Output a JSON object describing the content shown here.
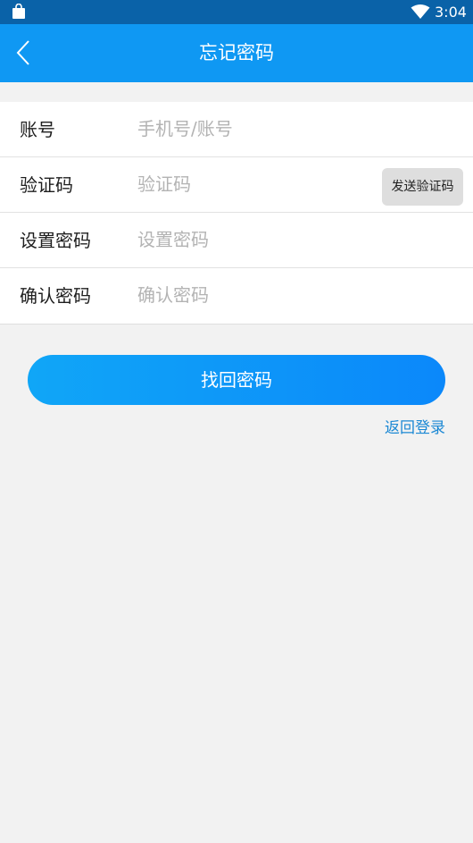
{
  "status_bar": {
    "time": "3:04",
    "icons": [
      "bag-icon",
      "wifi-icon"
    ]
  },
  "app_bar": {
    "title": "忘记密码",
    "back_icon": "chevron-left-icon"
  },
  "form": {
    "account": {
      "label": "账号",
      "placeholder": "手机号/账号",
      "value": ""
    },
    "code": {
      "label": "验证码",
      "placeholder": "验证码",
      "value": "",
      "send_label": "发送验证码"
    },
    "new_password": {
      "label": "设置密码",
      "placeholder": "设置密码",
      "value": ""
    },
    "confirm_password": {
      "label": "确认密码",
      "placeholder": "确认密码",
      "value": ""
    }
  },
  "actions": {
    "submit_label": "找回密码",
    "back_to_login_label": "返回登录"
  },
  "colors": {
    "status_bar": "#0a62a8",
    "app_bar": "#0f98f3",
    "button_start": "#10a6f7",
    "button_end": "#0b88fa",
    "link": "#1b88d4",
    "background": "#f2f2f2"
  }
}
